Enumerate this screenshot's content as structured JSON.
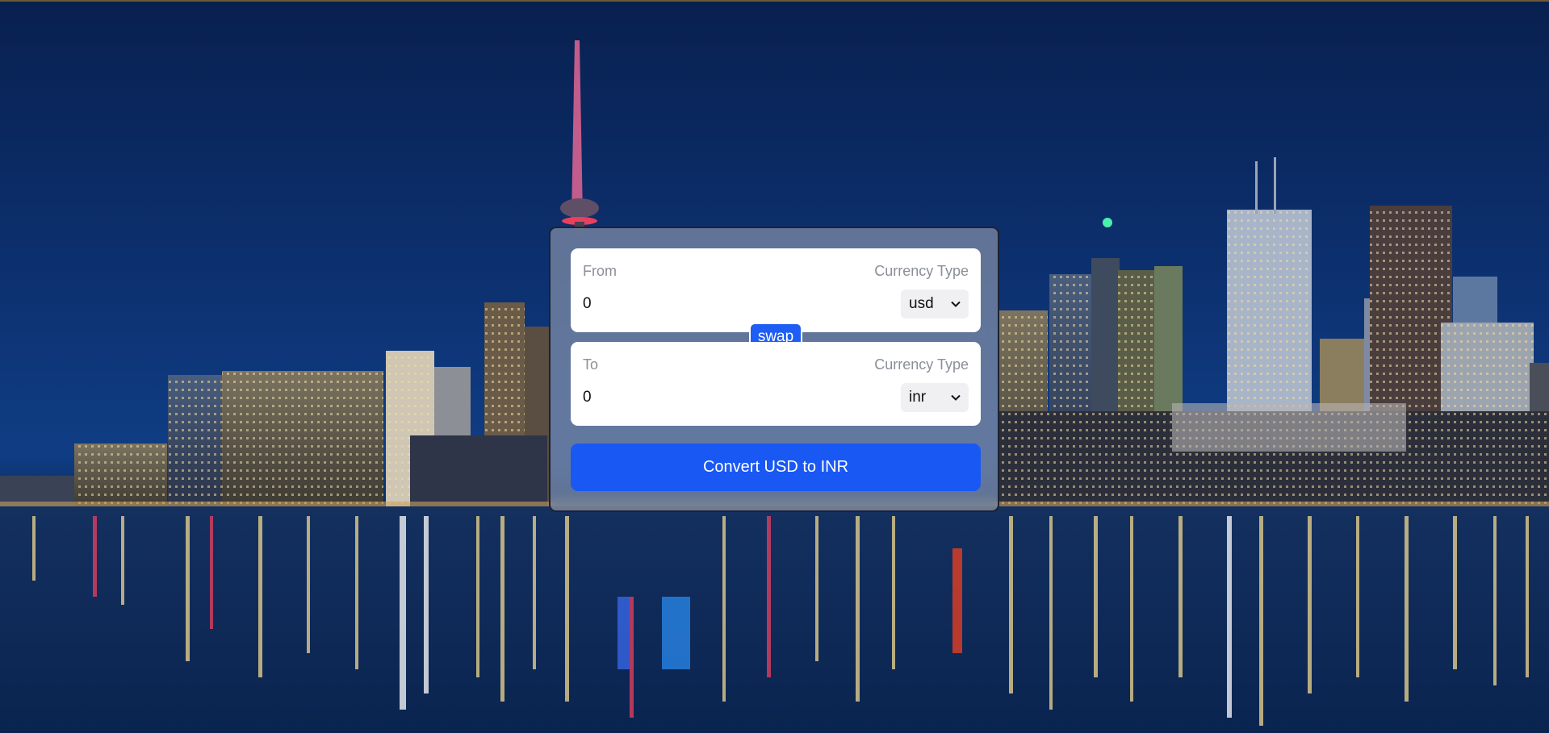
{
  "converter": {
    "from": {
      "label": "From",
      "currency_label": "Currency Type",
      "amount": "0",
      "currency": "usd"
    },
    "to": {
      "label": "To",
      "currency_label": "Currency Type",
      "amount": "0",
      "currency": "inr"
    },
    "swap_label": "swap",
    "convert_label": "Convert USD to INR"
  },
  "colors": {
    "accent": "#1a58f4",
    "sky": "#0d3272",
    "card_overlay": "#969eb2"
  },
  "icons": {
    "select_arrow": "chevron-down-icon"
  }
}
